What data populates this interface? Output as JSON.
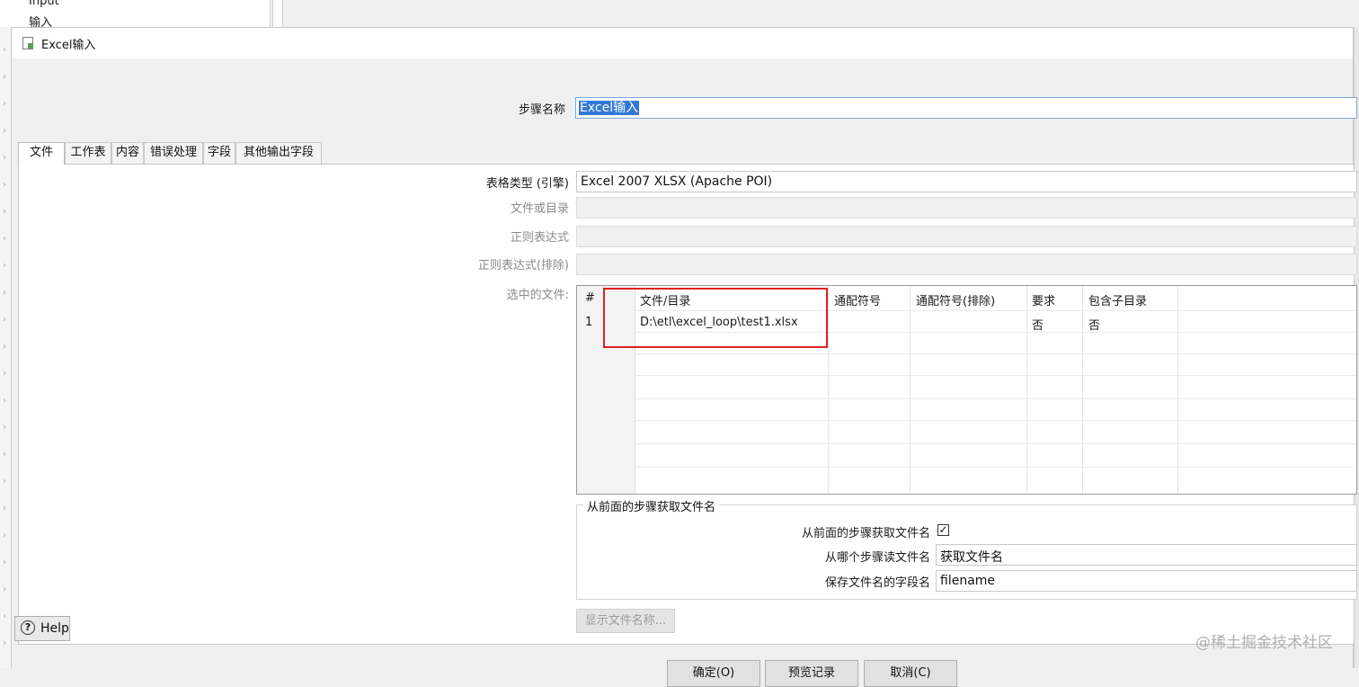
{
  "background": {
    "tree_items": [
      "Input",
      "输入"
    ]
  },
  "dialog": {
    "title": "Excel输入",
    "step_name_label": "步骤名称",
    "step_name_value": "Excel输入",
    "tabs": [
      "文件",
      "工作表",
      "内容",
      "错误处理",
      "字段",
      "其他输出字段"
    ],
    "active_tab": "文件",
    "file_tab": {
      "spreadsheet_type_label": "表格类型 (引擎)",
      "spreadsheet_type_value": "Excel 2007 XLSX (Apache POI)",
      "file_or_dir_label": "文件或目录",
      "regex_label": "正则表达式",
      "regex_exclude_label": "正则表达式(排除)",
      "selected_files_label": "选中的文件:",
      "table": {
        "headers": [
          "#",
          "文件/目录",
          "通配符号",
          "通配符号(排除)",
          "要求",
          "包含子目录"
        ],
        "rows": [
          [
            "1",
            "D:\\etl\\excel_loop\\test1.xlsx",
            "",
            "",
            "否",
            "否"
          ]
        ]
      },
      "prev_group": {
        "title": "从前面的步骤获取文件名",
        "accept_label": "从前面的步骤获取文件名",
        "accept_checked": true,
        "check_mark": "✓",
        "step_label": "从哪个步骤读文件名",
        "step_value": "获取文件名",
        "field_label": "保存文件名的字段名",
        "field_value": "filename"
      },
      "show_filenames_button": "显示文件名称..."
    },
    "buttons": {
      "ok": "确定(O)",
      "preview": "预览记录",
      "cancel": "取消(C)",
      "help": "Help",
      "help_glyph": "?"
    }
  },
  "watermark": "@稀土掘金技术社区"
}
